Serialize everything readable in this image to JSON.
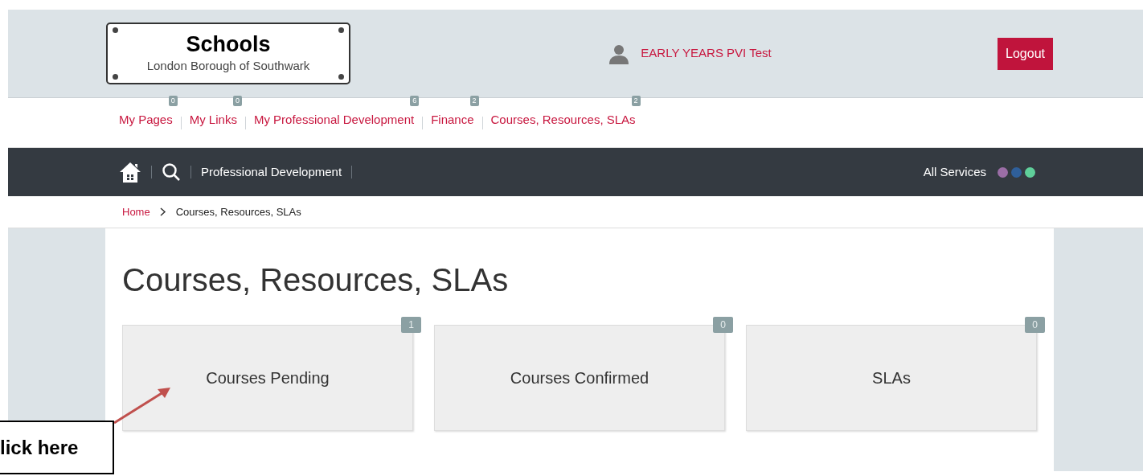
{
  "header": {
    "logo_title": "Schools",
    "logo_subtitle": "London Borough of Southwark",
    "user": "EARLY YEARS PVI Test",
    "logout": "Logout"
  },
  "nav": [
    {
      "label": "My Pages",
      "badge": "0"
    },
    {
      "label": "My Links",
      "badge": "0"
    },
    {
      "label": "My Professional Development",
      "badge": "6"
    },
    {
      "label": "Finance",
      "badge": "2"
    },
    {
      "label": "Courses, Resources, SLAs",
      "badge": "2"
    }
  ],
  "toolbar": {
    "section": "Professional Development",
    "all_services": "All Services",
    "dots": [
      {
        "color": "#9b6ea6"
      },
      {
        "color": "#2f5f9a"
      },
      {
        "color": "#5fcf9a"
      }
    ]
  },
  "breadcrumb": {
    "home": "Home",
    "current": "Courses, Resources, SLAs"
  },
  "heading": "Courses, Resources, SLAs",
  "tiles": [
    {
      "label": "Courses Pending",
      "count": "1"
    },
    {
      "label": "Courses Confirmed",
      "count": "0"
    },
    {
      "label": "SLAs",
      "count": "0"
    }
  ],
  "callout": "lick here"
}
